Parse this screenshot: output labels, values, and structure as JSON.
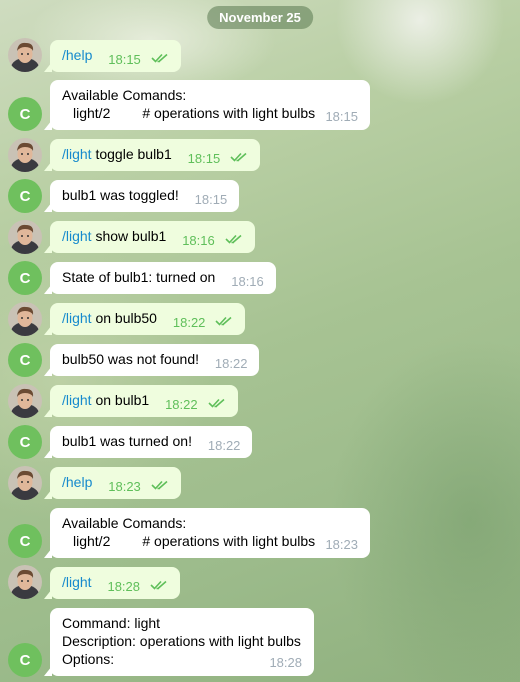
{
  "date_label": "November 25",
  "avatar_letter": "C",
  "messages": [
    {
      "dir": "out",
      "cmd": "/help",
      "text": "",
      "time": "18:15"
    },
    {
      "dir": "in",
      "lines": [
        "Available Comands:",
        "light/2",
        "# operations with light bulbs"
      ],
      "time": "18:15"
    },
    {
      "dir": "out",
      "cmd": "/light",
      "text": " toggle bulb1",
      "time": "18:15"
    },
    {
      "dir": "in",
      "text": "bulb1 was toggled!",
      "time": "18:15"
    },
    {
      "dir": "out",
      "cmd": "/light",
      "text": " show bulb1",
      "time": "18:16"
    },
    {
      "dir": "in",
      "text": "State of bulb1: turned on",
      "time": "18:16"
    },
    {
      "dir": "out",
      "cmd": "/light",
      "text": " on bulb50",
      "time": "18:22"
    },
    {
      "dir": "in",
      "text": "bulb50 was not found!",
      "time": "18:22"
    },
    {
      "dir": "out",
      "cmd": "/light",
      "text": " on bulb1",
      "time": "18:22"
    },
    {
      "dir": "in",
      "text": "bulb1 was turned on!",
      "time": "18:22"
    },
    {
      "dir": "out",
      "cmd": "/help",
      "text": "",
      "time": "18:23"
    },
    {
      "dir": "in",
      "lines": [
        "Available Comands:",
        "light/2",
        "# operations with light bulbs"
      ],
      "time": "18:23"
    },
    {
      "dir": "out",
      "cmd": "/light",
      "text": "",
      "time": "18:28"
    },
    {
      "dir": "in",
      "lines": [
        "Command: light",
        "Description: operations with light bulbs",
        "Options:"
      ],
      "time": "18:28"
    }
  ],
  "colors": {
    "outgoing_bubble": "#effdde",
    "incoming_bubble": "#ffffff",
    "command_link": "#168acd",
    "bot_avatar": "#6fc05e",
    "read_check": "#5fbf5a"
  },
  "icons": {
    "read_status": "double-check-icon",
    "user_avatar": "user-avatar-photo"
  }
}
